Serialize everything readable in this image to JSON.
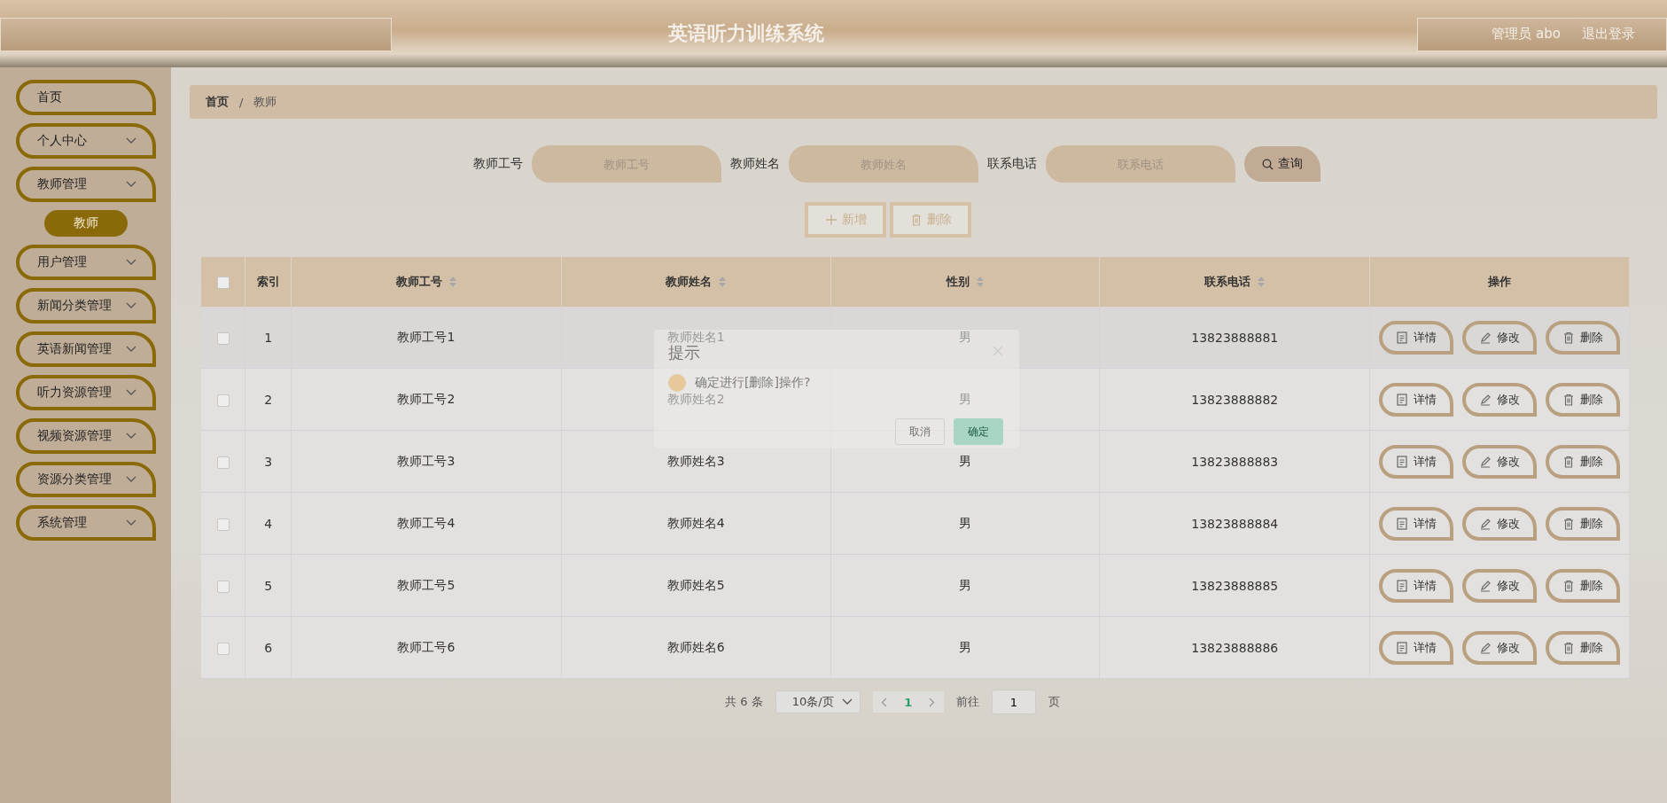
{
  "header": {
    "title": "英语听力训练系统",
    "user": "管理员 abo",
    "logout": "退出登录"
  },
  "sidebar": {
    "items": [
      {
        "label": "首页",
        "expandable": false
      },
      {
        "label": "个人中心",
        "expandable": true
      },
      {
        "label": "教师管理",
        "expandable": true,
        "children": [
          {
            "label": "教师",
            "selected": true
          }
        ]
      },
      {
        "label": "用户管理",
        "expandable": true
      },
      {
        "label": "新闻分类管理",
        "expandable": true
      },
      {
        "label": "英语新闻管理",
        "expandable": true
      },
      {
        "label": "听力资源管理",
        "expandable": true
      },
      {
        "label": "视频资源管理",
        "expandable": true
      },
      {
        "label": "资源分类管理",
        "expandable": true
      },
      {
        "label": "系统管理",
        "expandable": true
      }
    ]
  },
  "breadcrumb": {
    "items": [
      "首页",
      "教师"
    ],
    "separator": "/"
  },
  "search": {
    "fields": [
      {
        "label": "教师工号",
        "placeholder": "教师工号"
      },
      {
        "label": "教师姓名",
        "placeholder": "教师姓名"
      },
      {
        "label": "联系电话",
        "placeholder": "联系电话"
      }
    ],
    "button": "查询"
  },
  "toolbar": [
    {
      "kind": "add",
      "label": "新增"
    },
    {
      "kind": "delete",
      "label": "删除"
    }
  ],
  "table": {
    "all_checked": false,
    "columns": [
      {
        "label": "索引",
        "sortable": false
      },
      {
        "label": "教师工号",
        "sortable": true
      },
      {
        "label": "教师姓名",
        "sortable": true
      },
      {
        "label": "性别",
        "sortable": true
      },
      {
        "label": "联系电话",
        "sortable": true
      },
      {
        "label": "操作",
        "sortable": false
      }
    ],
    "rows": [
      {
        "checked": false,
        "cells": [
          "1",
          "教师工号1",
          "教师姓名1",
          "男",
          "13823888881"
        ],
        "actions": [
          {
            "kind": "detail",
            "label": "详情"
          },
          {
            "kind": "edit",
            "label": "修改"
          },
          {
            "kind": "delete",
            "label": "删除"
          }
        ]
      },
      {
        "checked": false,
        "cells": [
          "2",
          "教师工号2",
          "教师姓名2",
          "男",
          "13823888882"
        ],
        "actions": [
          {
            "kind": "detail",
            "label": "详情"
          },
          {
            "kind": "edit",
            "label": "修改"
          },
          {
            "kind": "delete",
            "label": "删除"
          }
        ]
      },
      {
        "checked": false,
        "cells": [
          "3",
          "教师工号3",
          "教师姓名3",
          "男",
          "13823888883"
        ],
        "actions": [
          {
            "kind": "detail",
            "label": "详情"
          },
          {
            "kind": "edit",
            "label": "修改"
          },
          {
            "kind": "delete",
            "label": "删除"
          }
        ]
      },
      {
        "checked": false,
        "cells": [
          "4",
          "教师工号4",
          "教师姓名4",
          "男",
          "13823888884"
        ],
        "actions": [
          {
            "kind": "detail",
            "label": "详情"
          },
          {
            "kind": "edit",
            "label": "修改"
          },
          {
            "kind": "delete",
            "label": "删除"
          }
        ]
      },
      {
        "checked": false,
        "cells": [
          "5",
          "教师工号5",
          "教师姓名5",
          "男",
          "13823888885"
        ],
        "actions": [
          {
            "kind": "detail",
            "label": "详情"
          },
          {
            "kind": "edit",
            "label": "修改"
          },
          {
            "kind": "delete",
            "label": "删除"
          }
        ]
      },
      {
        "checked": false,
        "cells": [
          "6",
          "教师工号6",
          "教师姓名6",
          "男",
          "13823888886"
        ],
        "actions": [
          {
            "kind": "detail",
            "label": "详情"
          },
          {
            "kind": "edit",
            "label": "修改"
          },
          {
            "kind": "delete",
            "label": "删除"
          }
        ]
      }
    ]
  },
  "pagination": {
    "total": "共 6 条",
    "page_size": "10条/页",
    "pages": [
      {
        "label": "1",
        "selected": true
      }
    ],
    "goto_label": "前往",
    "goto_value": "1",
    "goto_suffix": "页"
  },
  "dialog": {
    "title": "提示",
    "message": "确定进行[删除]操作?",
    "buttons": [
      {
        "kind": "cancel",
        "label": "取消"
      },
      {
        "kind": "confirm",
        "label": "确定"
      }
    ]
  }
}
